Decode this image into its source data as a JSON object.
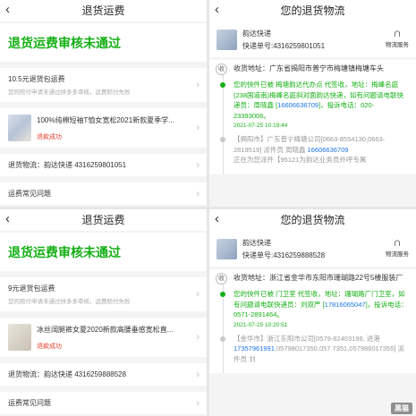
{
  "q1": {
    "title": "退货运费",
    "banner": "退货运费审核未通过",
    "fee_title": "10.5元退货包运费",
    "fee_note": "您的赔付申请未通过拼多多审核，运费赔付失败",
    "product_title": "100%纯棉短袖T恤女宽松2021新款夏季学...",
    "product_status": "退款成功",
    "logistics_row": "退货物流：韵达快递 4316259801051",
    "faq": "运费常见问题"
  },
  "q2": {
    "title": "您的退货物流",
    "carrier": "韵达快递",
    "tracking": "快递单号:4316259801051",
    "service": "物流服务",
    "address_badge": "收",
    "address": "收货地址：广东省揭阳市普宁市梅塘镇梅塘车头",
    "event1_text": "您的快件已被 梅塘韵达代办点 代签收，地址：梅峰名庭(238国道南)梅峰名庭斜对面韵达快递，如有问题请电联快递员：周晓鑫 [",
    "event1_phone": "16606636709",
    "event1_tail": "]，投诉电话：020-23393006。",
    "event1_time": "2021-07-25 10:19:44",
    "event2_text": "【揭阳市】广东普宁梅塘公司[0663-8554130,0663-2819519] 派件员 周晓鑫 ",
    "event2_phone": "16606636709",
    "event2_tail": "正在为您派件【95121为韵达业务员外呼专属"
  },
  "q3": {
    "title": "退货运费",
    "banner": "退货运费审核未通过",
    "fee_title": "9元退货包运费",
    "fee_note": "您的赔付申请未通过拼多多审核，运费赔付失败",
    "product_title": "冰丝阔腿裤女夏2020新款高腰垂感宽松直...",
    "product_status": "退款成功",
    "logistics_row": "退货物流：韵达快递 4316259888528",
    "faq": "运费常见问题"
  },
  "q4": {
    "title": "您的退货物流",
    "carrier": "韵达快递",
    "tracking": "快递单号:4316259888528",
    "service": "物流服务",
    "address_badge": "收",
    "address": "收货地址：浙江省金华市东阳市珊瑚路22号5楼服装厂",
    "event1_text": "您的快件已被 门卫室 代签收，地址：珊瑚路厂门卫室，如有问题请电联快递员：刘双严 [",
    "event1_phone": "17816065047",
    "event1_tail": "]，投诉电话：0571-2891464。",
    "event1_time": "2021-07-25 10:20:51",
    "event2_text": "【金华市】浙江东阳市公司[0579-82403198, 进港",
    "event2_phone": "17357961991",
    "event2_tail": ",05798017350,057 7351,057986017355] 派件员 刘"
  },
  "watermark": "黑猫"
}
